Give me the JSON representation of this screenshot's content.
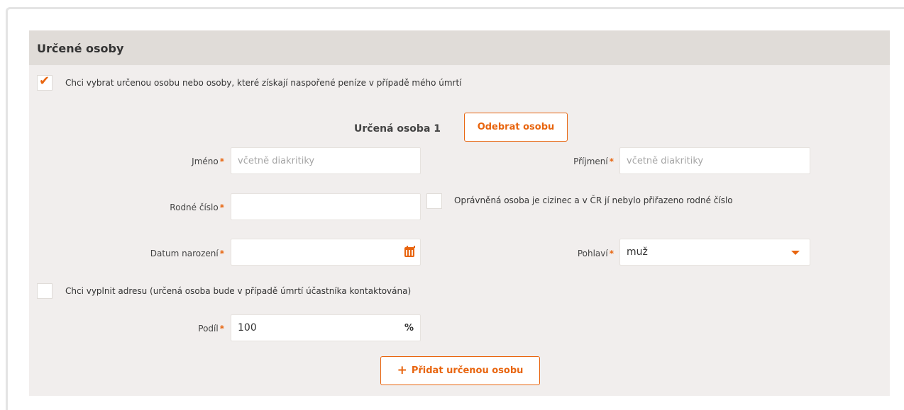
{
  "section": {
    "title": "Určené osoby"
  },
  "choose_person": {
    "checked": true,
    "label": "Chci vybrat určenou osobu nebo osoby, které získají naspořené peníze v případě mého úmrtí"
  },
  "person": {
    "title": "Určená osoba 1",
    "remove_label": "Odebrat osobu",
    "first_name": {
      "label": "Jméno",
      "required_mark": "*",
      "placeholder": "včetně diakritiky",
      "value": ""
    },
    "last_name": {
      "label": "Příjmení",
      "required_mark": "*",
      "placeholder": "včetně diakritiky",
      "value": ""
    },
    "birth_number": {
      "label": "Rodné číslo",
      "required_mark": "*",
      "value": ""
    },
    "foreigner": {
      "checked": false,
      "label": "Oprávněná osoba je cizinec a v ČR jí nebylo přiřazeno rodné číslo"
    },
    "birth_date": {
      "label": "Datum narození",
      "required_mark": "*",
      "value": "",
      "icon": "calendar-icon"
    },
    "gender": {
      "label": "Pohlaví",
      "required_mark": "*",
      "selected": "muž",
      "icon": "chevron-down-icon"
    },
    "address": {
      "checked": false,
      "label": "Chci vyplnit adresu (určená osoba bude v případě úmrtí účastníka kontaktována)"
    },
    "share": {
      "label": "Podíl",
      "required_mark": "*",
      "value": "100",
      "unit": "%"
    }
  },
  "add_person": {
    "label": "Přidat určenou osobu",
    "icon": "plus-icon"
  },
  "colors": {
    "accent": "#e8650f",
    "panel_bg": "#f1eeed",
    "header_bg": "#e0dcd8"
  }
}
